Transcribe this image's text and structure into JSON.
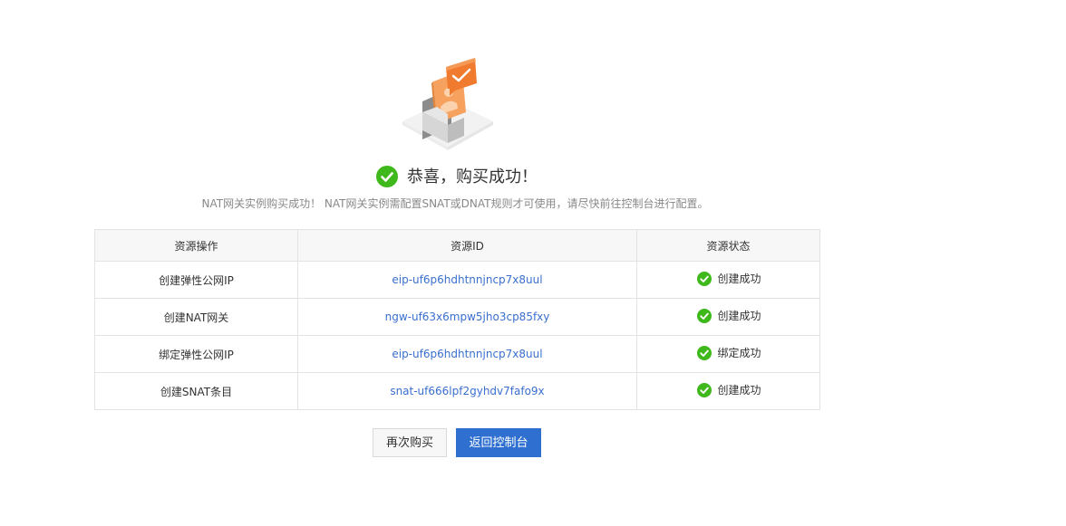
{
  "success": {
    "title": "恭喜，购买成功！",
    "subtitle": "NAT网关实例购买成功！ NAT网关实例需配置SNAT或DNAT规则才可使用，请尽快前往控制台进行配置。"
  },
  "table": {
    "headers": [
      "资源操作",
      "资源ID",
      "资源状态"
    ],
    "rows": [
      {
        "operation": "创建弹性公网IP",
        "resource_id": "eip-uf6p6hdhtnnjncp7x8uul",
        "status": "创建成功"
      },
      {
        "operation": "创建NAT网关",
        "resource_id": "ngw-uf63x6mpw5jho3cp85fxy",
        "status": "创建成功"
      },
      {
        "operation": "绑定弹性公网IP",
        "resource_id": "eip-uf6p6hdhtnnjncp7x8uul",
        "status": "绑定成功"
      },
      {
        "operation": "创建SNAT条目",
        "resource_id": "snat-uf666lpf2gyhdv7fafo9x",
        "status": "创建成功"
      }
    ]
  },
  "buttons": {
    "buy_again": "再次购买",
    "back_to_console": "返回控制台"
  },
  "colors": {
    "success_green": "#3fb81b",
    "link_blue": "#3a6fcf",
    "primary_button": "#2e6fd0",
    "illustration_orange": "#f07a2e"
  },
  "icons": {
    "headline": "success-check-icon",
    "row_status": "success-check-icon",
    "illustration": "purchase-success-illustration"
  }
}
